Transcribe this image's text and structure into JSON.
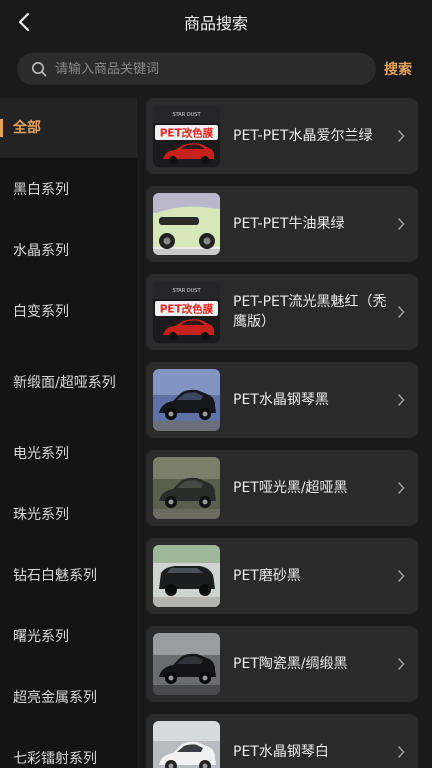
{
  "header": {
    "title": "商品搜索"
  },
  "search": {
    "placeholder": "请输入商品关键词",
    "button_label": "搜索"
  },
  "sidebar": {
    "items": [
      {
        "label": "全部",
        "active": true
      },
      {
        "label": "黑白系列"
      },
      {
        "label": "水晶系列"
      },
      {
        "label": "白变系列"
      },
      {
        "label": "新缎面/超哑系列"
      },
      {
        "label": "电光系列"
      },
      {
        "label": "珠光系列"
      },
      {
        "label": "钻石白魅系列"
      },
      {
        "label": "曙光系列"
      },
      {
        "label": "超亮金属系列"
      },
      {
        "label": "七彩镭射系列"
      }
    ]
  },
  "products": [
    {
      "title": "PET-PET水晶爱尔兰绿",
      "thumb": "poster",
      "poster_brand": "STAR DUST",
      "poster_text": "PET改色膜"
    },
    {
      "title": "PET-PET牛油果绿",
      "thumb": "green-car"
    },
    {
      "title": "PET-PET流光黑魅红（秃鹰版）",
      "thumb": "poster",
      "poster_brand": "STAR DUST",
      "poster_text": "PET改色膜"
    },
    {
      "title": "PET水晶钢琴黑",
      "thumb": "black-car-blue"
    },
    {
      "title": "PET哑光黑/超哑黑",
      "thumb": "matte-car"
    },
    {
      "title": "PET磨砂黑",
      "thumb": "suv"
    },
    {
      "title": "PET陶瓷黑/绸缎黑",
      "thumb": "black-car-grey"
    },
    {
      "title": "PET水晶钢琴白",
      "thumb": "white-car"
    }
  ],
  "colors": {
    "accent": "#e3a35c",
    "background": "#1a1a1a",
    "card": "#2a2a2a",
    "sidebar": "#141414"
  },
  "icons": {
    "back": "chevron-left-icon",
    "search": "search-icon",
    "row": "chevron-right-icon"
  }
}
